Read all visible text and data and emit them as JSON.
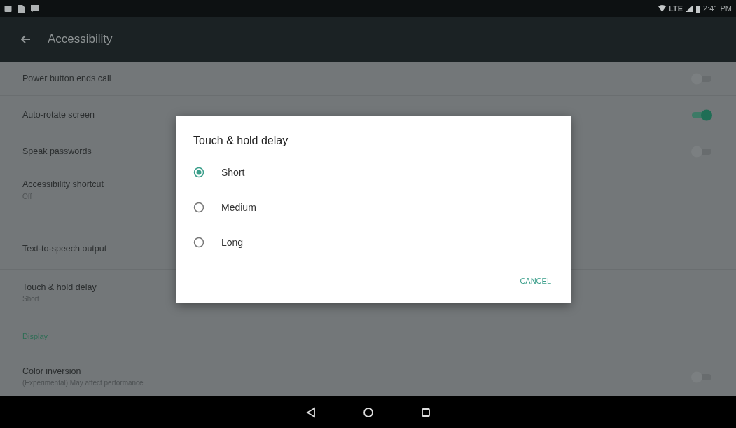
{
  "status_bar": {
    "lte": "LTE",
    "time": "2:41 PM"
  },
  "app_bar": {
    "title": "Accessibility"
  },
  "settings": [
    {
      "kind": "switch",
      "title": "Power button ends call",
      "on": false
    },
    {
      "kind": "switch",
      "title": "Auto-rotate screen",
      "on": true
    },
    {
      "kind": "switch",
      "title": "Speak passwords",
      "on": false
    },
    {
      "kind": "item",
      "title": "Accessibility shortcut",
      "summary": "Off"
    },
    {
      "kind": "item",
      "title": "Text-to-speech output"
    },
    {
      "kind": "item",
      "title": "Touch & hold delay",
      "summary": "Short"
    },
    {
      "kind": "header",
      "title": "Display"
    },
    {
      "kind": "switch",
      "title": "Color inversion",
      "summary": "(Experimental) May affect performance",
      "on": false
    }
  ],
  "dialog": {
    "title": "Touch & hold delay",
    "options": [
      {
        "label": "Short",
        "selected": true
      },
      {
        "label": "Medium",
        "selected": false
      },
      {
        "label": "Long",
        "selected": false
      }
    ],
    "button": "CANCEL"
  }
}
